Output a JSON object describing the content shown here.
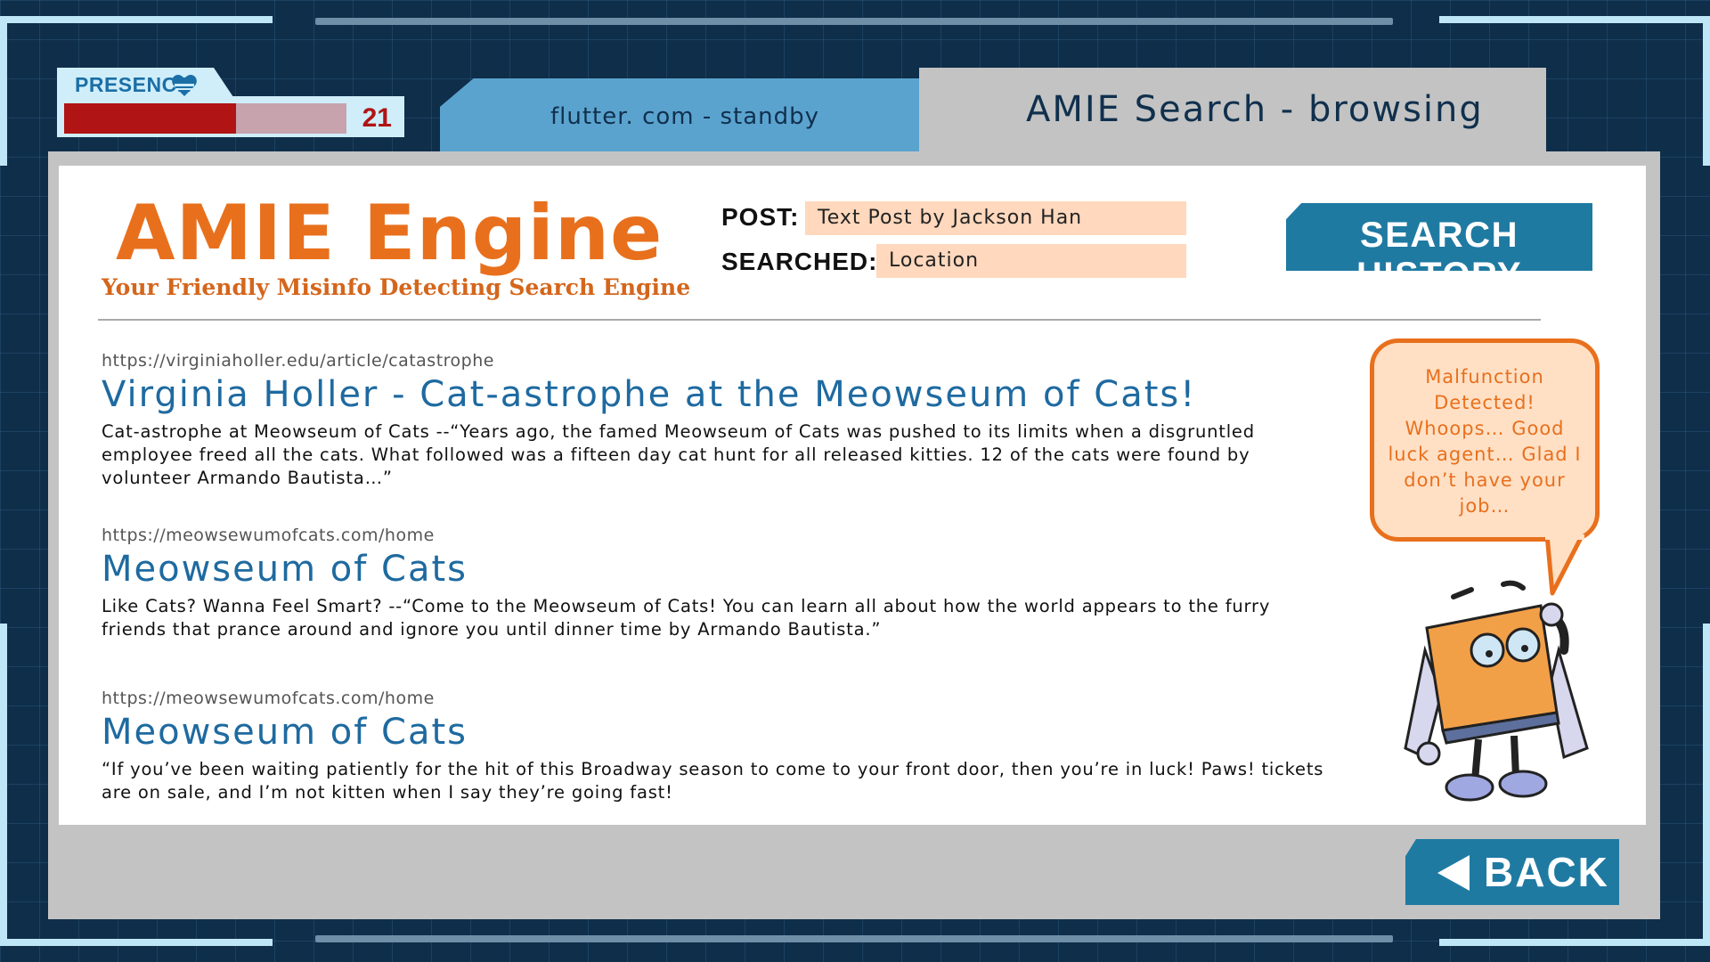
{
  "presence": {
    "label": "PRESENCE",
    "value": "21",
    "fill_fraction": 0.61
  },
  "tabs": {
    "inactive_label": "flutter. com - standby",
    "active_label": "AMIE Search - browsing"
  },
  "engine": {
    "title": "AMIE Engine",
    "subtitle": "Your Friendly Misinfo Detecting Search Engine"
  },
  "query": {
    "post_label": "POST:",
    "post_value": "Text Post by Jackson Han",
    "searched_label": "SEARCHED:",
    "searched_value": "Location"
  },
  "search_history_label": "SEARCH HISTORY",
  "results": [
    {
      "url": "https://virginiaholler.edu/article/catastrophe",
      "title": "Virginia Holler  - Cat-astrophe at the Meowseum of Cats!",
      "snippet": "Cat-astrophe at Meowseum of Cats --“Years ago, the famed Meowseum of Cats was pushed to its limits when a disgruntled employee freed all the cats. What followed was a fifteen day cat hunt for all released kitties. 12 of the cats were found by volunteer Armando Bautista…”"
    },
    {
      "url": "https://meowsewumofcats.com/home",
      "title": "Meowseum of Cats",
      "snippet": "Like Cats? Wanna Feel Smart? --“Come to the Meowseum of Cats! You can learn all about how the world appears to the furry friends that prance around and ignore you until dinner time by Armando Bautista.”"
    },
    {
      "url": "https://meowsewumofcats.com/home",
      "title": "Meowseum of Cats",
      "snippet": "“If you’ve been waiting patiently for the hit of this Broadway season to come to your front door, then you’re in luck! Paws! tickets are on sale, and I’m not kitten when I say they’re going fast!"
    }
  ],
  "assistant": {
    "bubble_text": "Malfunction Detected! Whoops… Good luck agent… Glad I don’t have your job…"
  },
  "back_label": "BACK",
  "colors": {
    "accent_orange": "#e8701d",
    "button_blue": "#1f7aa2",
    "title_blue": "#1e6aa0",
    "meter_red": "#b01414"
  }
}
